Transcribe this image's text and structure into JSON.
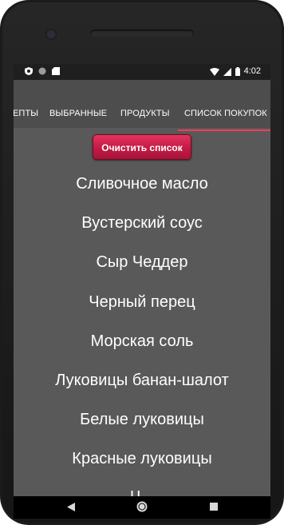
{
  "status_bar": {
    "time": "4:02",
    "left_icons": [
      "shield-icon",
      "circle-icon",
      "sd-card-icon"
    ],
    "right_icons": [
      "wifi-icon",
      "signal-icon",
      "battery-icon"
    ]
  },
  "tabs": [
    {
      "label": "ЕПТЫ",
      "active": false
    },
    {
      "label": "ВЫБРАННЫЕ",
      "active": false
    },
    {
      "label": "ПРОДУКТЫ",
      "active": false
    },
    {
      "label": "СПИСОК ПОКУПОК",
      "active": true
    }
  ],
  "clear_button": {
    "label": "Очистить список"
  },
  "shopping_list": [
    "Сливочное масло",
    "Вустерский соус",
    "Сыр Чеддер",
    "Черный перец",
    "Морская соль",
    "Луковицы банан-шалот",
    "Белые луковицы",
    "Красные луковицы",
    "Ч..."
  ],
  "nav_bar": {
    "buttons": [
      "back-icon",
      "home-icon",
      "recents-icon"
    ]
  },
  "colors": {
    "accent": "#f03d5a",
    "button": "#c31a45",
    "screen_bg": "#595959",
    "appbar_bg": "#4d4d4d"
  }
}
